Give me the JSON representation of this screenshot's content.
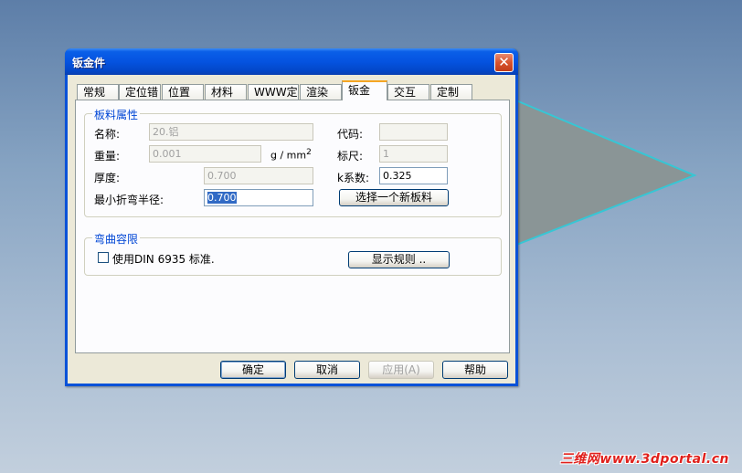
{
  "dialog": {
    "title": "钣金件",
    "close_symbol": "✕"
  },
  "tabs": [
    {
      "label": "常规",
      "active": false
    },
    {
      "label": "定位错",
      "active": false
    },
    {
      "label": "位置",
      "active": false
    },
    {
      "label": "材料",
      "active": false
    },
    {
      "label": "WWW定位",
      "active": false
    },
    {
      "label": "渲染",
      "active": false
    },
    {
      "label": "钣金",
      "active": true
    },
    {
      "label": "交互",
      "active": false
    },
    {
      "label": "定制",
      "active": false
    }
  ],
  "sheet_material": {
    "group_title": "板料属性",
    "name_label": "名称:",
    "name_value": "20.铝",
    "weight_label": "重量:",
    "weight_value": "0.001",
    "weight_unit": "g / mm",
    "weight_unit_sup": "2",
    "thickness_label": "厚度:",
    "thickness_value": "0.700",
    "min_bend_radius_label": "最小折弯半径:",
    "min_bend_radius_value": "0.700",
    "code_label": "代码:",
    "code_value": "",
    "gauge_label": "标尺:",
    "gauge_value": "1",
    "k_factor_label": "k系数:",
    "k_factor_value": "0.325",
    "select_material_button": "选择一个新板料"
  },
  "bend_allowance": {
    "group_title": "弯曲容限",
    "din_checkbox_label": "使用DIN 6935 标准.",
    "din_checked": false,
    "show_rules_button": "显示规则 .."
  },
  "footer": {
    "ok_button": "确定",
    "cancel_button": "取消",
    "apply_button": "应用(A)",
    "help_button": "帮助"
  },
  "watermark": "三维网www.3dportal.cn",
  "colors": {
    "titlebar": "#0553e0",
    "active_tab_accent": "#f5a623",
    "group_title": "#0046d5",
    "selection": "#316ac5",
    "shape_fill": "#8a9596",
    "shape_edge": "#37c6d4",
    "watermark": "#e0201c"
  }
}
